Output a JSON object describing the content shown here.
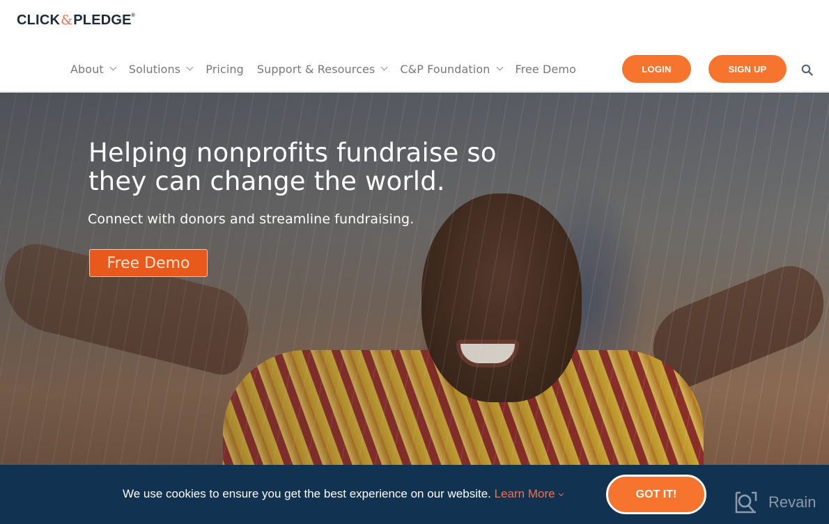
{
  "brand": {
    "logo_left": "CLICK",
    "logo_amp": "&",
    "logo_right": "PLEDGE",
    "logo_reg": "®",
    "accent_color": "#f7742e",
    "navy_color": "#123251"
  },
  "nav": {
    "items": [
      {
        "label": "About",
        "has_dropdown": true
      },
      {
        "label": "Solutions",
        "has_dropdown": true
      },
      {
        "label": "Pricing",
        "has_dropdown": false
      },
      {
        "label": "Support & Resources",
        "has_dropdown": true
      },
      {
        "label": "C&P Foundation",
        "has_dropdown": true
      },
      {
        "label": "Free Demo",
        "has_dropdown": false
      }
    ],
    "login_label": "LOGIN",
    "signup_label": "SIGN UP",
    "search_icon": "search-icon"
  },
  "hero": {
    "title": "Helping nonprofits fundraise so they can change the world.",
    "subtitle": "Connect with donors and streamline fundraising.",
    "cta_label": "Free Demo",
    "image_alt": "Smiling child in the rain with arms outstretched"
  },
  "cookie_bar": {
    "message": "We use cookies to ensure you get the best experience on our website.",
    "learn_more_label": "Learn More",
    "accept_label": "GOT IT!"
  },
  "watermark": {
    "label": "Revain"
  }
}
